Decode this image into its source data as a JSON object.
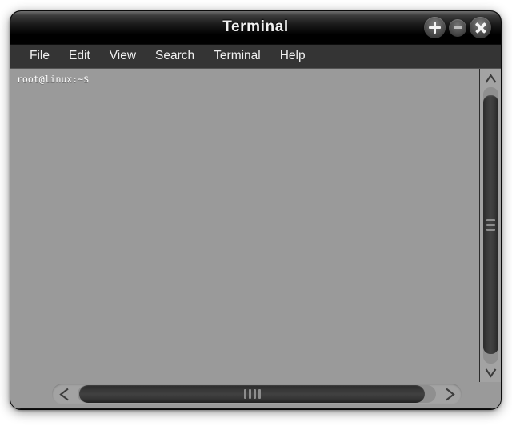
{
  "window": {
    "title": "Terminal",
    "controls": [
      {
        "name": "maximize-button",
        "glyph": "plus-icon",
        "label": "+"
      },
      {
        "name": "minimize-button",
        "glyph": "minus-icon",
        "label": "−"
      },
      {
        "name": "close-button",
        "glyph": "close-icon",
        "label": "×"
      }
    ],
    "colors": {
      "titlebar_top": "#6f6f6f",
      "titlebar_bottom": "#000000",
      "menubar_bg": "#343434",
      "terminal_bg": "#9a9a9a",
      "terminal_fg": "#ffffff",
      "scrollbar_trough": "#8f8f8f",
      "scrollbar_thumb": "#3a3a3a",
      "page_bg": "#ffffff"
    }
  },
  "menubar": {
    "items": [
      {
        "label": "File"
      },
      {
        "label": "Edit"
      },
      {
        "label": "View"
      },
      {
        "label": "Search"
      },
      {
        "label": "Terminal"
      },
      {
        "label": "Help"
      }
    ]
  },
  "terminal": {
    "prompt": "root@linux:~$",
    "lines": [
      "root@linux:~$"
    ],
    "content": "root@linux:~$"
  },
  "scrollbars": {
    "vertical": {
      "up_arrow_glyph": "∧",
      "down_arrow_glyph": "∨",
      "grip_count": 3
    },
    "horizontal": {
      "left_arrow_glyph": "<",
      "right_arrow_glyph": ">",
      "grip_count": 4
    }
  }
}
